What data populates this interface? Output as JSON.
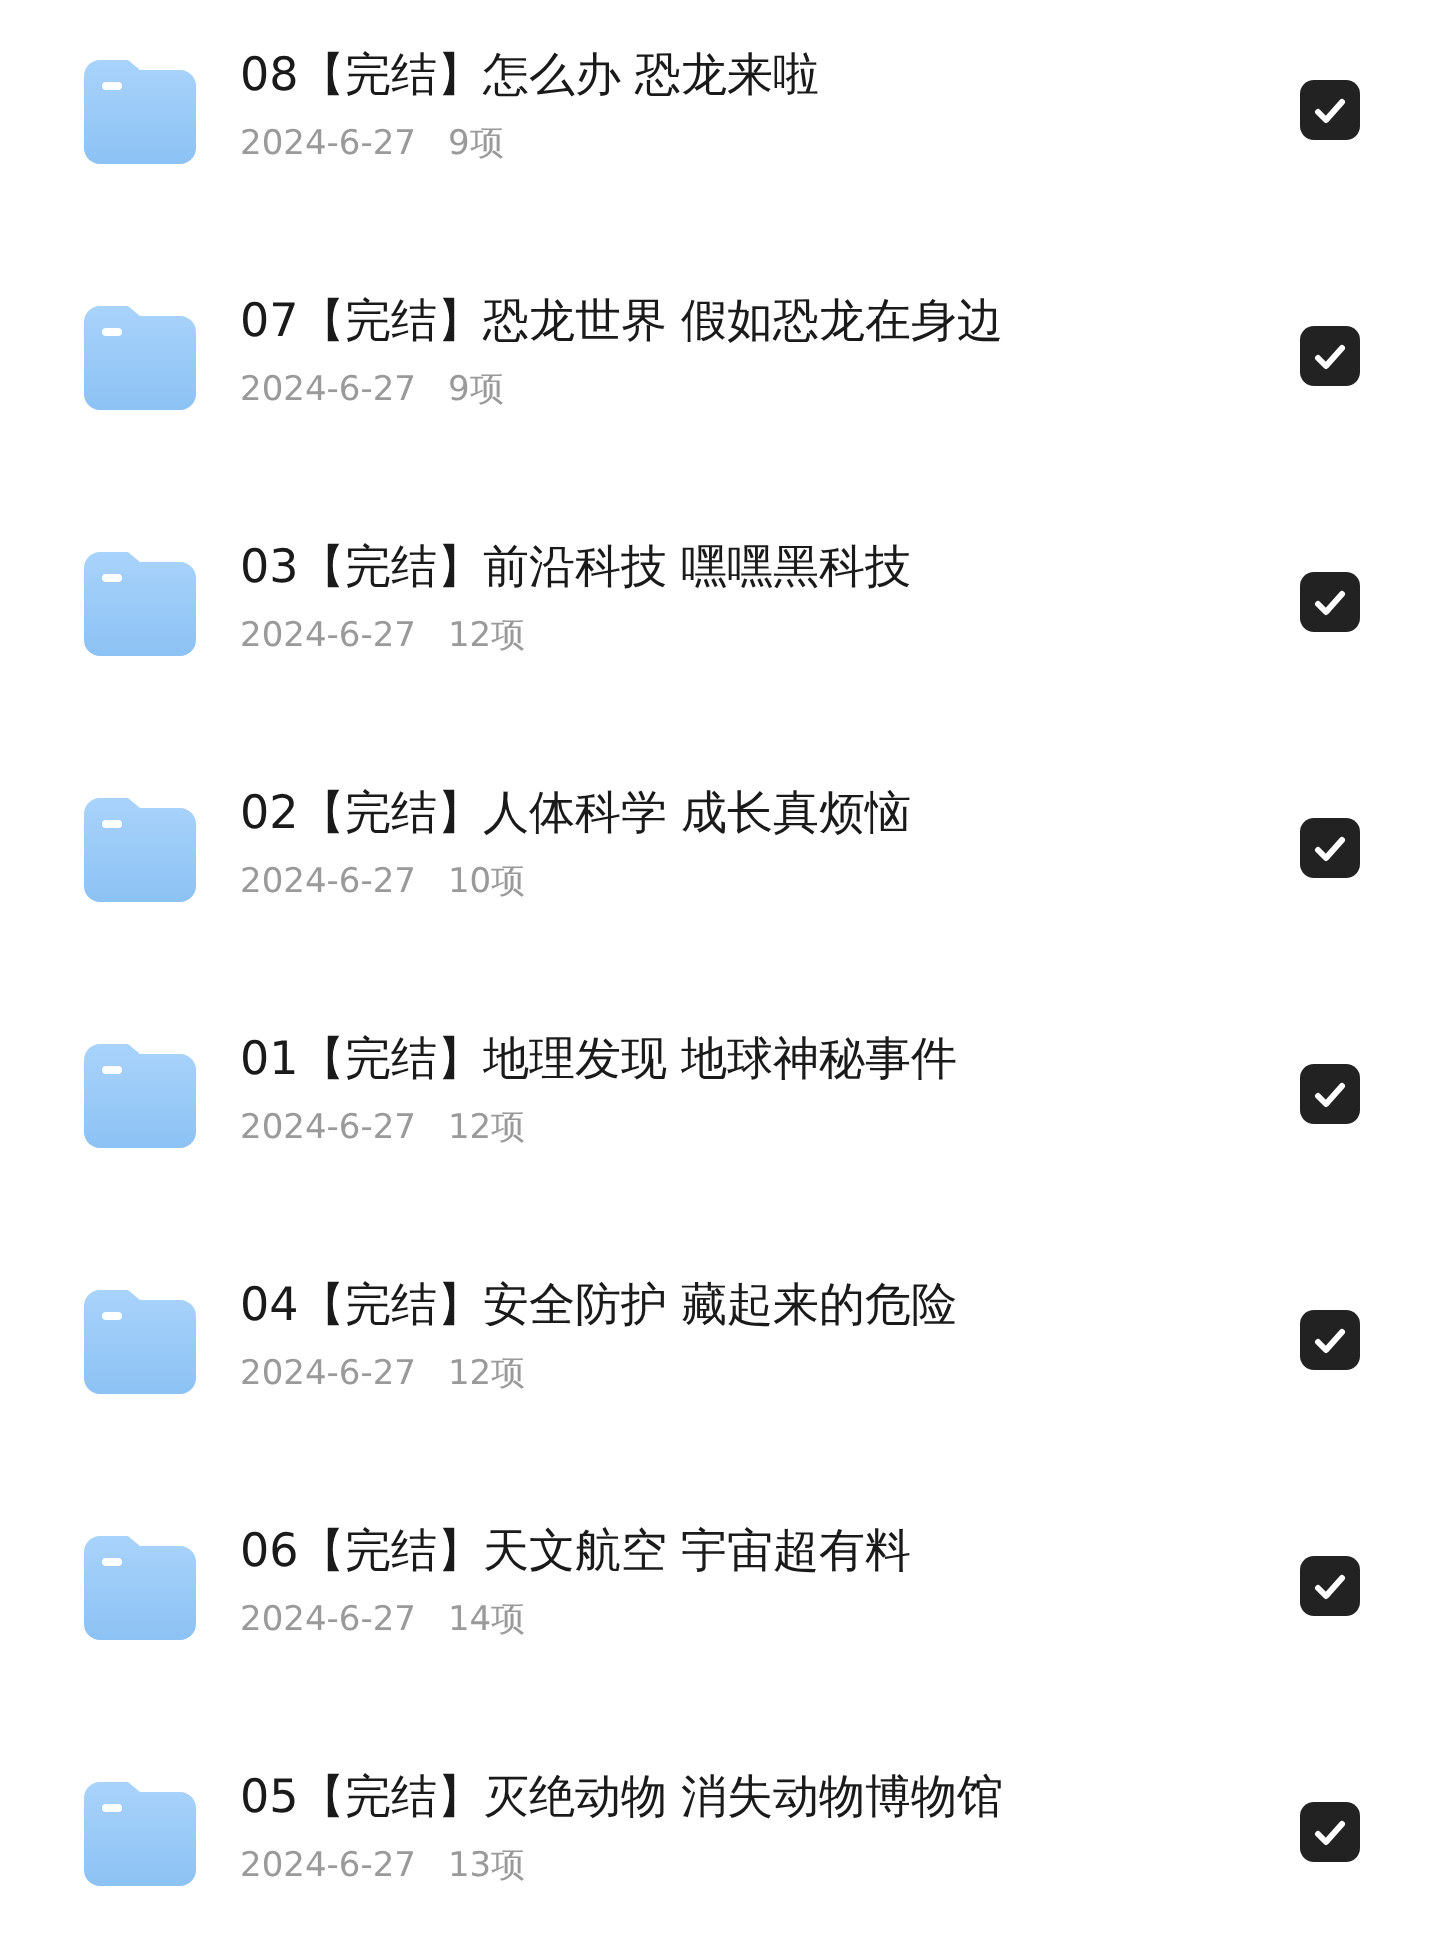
{
  "folders": [
    {
      "title": "08【完结】怎么办 恐龙来啦",
      "date": "2024-6-27",
      "count": "9项",
      "checked": true
    },
    {
      "title": "07【完结】恐龙世界 假如恐龙在身边",
      "date": "2024-6-27",
      "count": "9项",
      "checked": true
    },
    {
      "title": "03【完结】前沿科技 嘿嘿黑科技",
      "date": "2024-6-27",
      "count": "12项",
      "checked": true
    },
    {
      "title": "02【完结】人体科学 成长真烦恼",
      "date": "2024-6-27",
      "count": "10项",
      "checked": true
    },
    {
      "title": "01【完结】地理发现 地球神秘事件",
      "date": "2024-6-27",
      "count": "12项",
      "checked": true
    },
    {
      "title": "04【完结】安全防护 藏起来的危险",
      "date": "2024-6-27",
      "count": "12项",
      "checked": true
    },
    {
      "title": "06【完结】天文航空 宇宙超有料",
      "date": "2024-6-27",
      "count": "14项",
      "checked": true
    },
    {
      "title": "05【完结】灭绝动物 消失动物博物馆",
      "date": "2024-6-27",
      "count": "13项",
      "checked": true
    }
  ]
}
